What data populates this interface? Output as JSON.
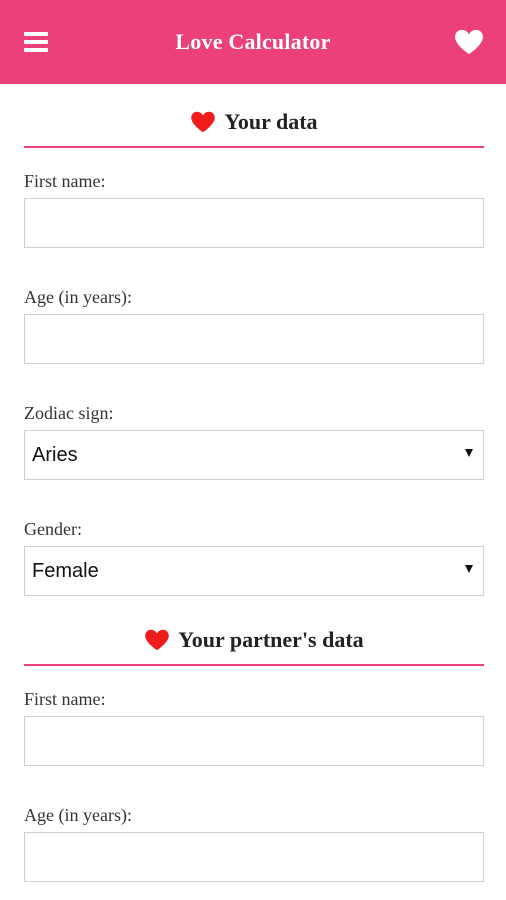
{
  "appbar": {
    "title": "Love Calculator",
    "background": "#ec407a",
    "menu_icon": "hamburger-icon",
    "action_icon": "heart-icon"
  },
  "your_data": {
    "heading": "Your data",
    "heading_icon": "heart-icon",
    "first_name_label": "First name:",
    "first_name_value": "",
    "age_label": "Age (in years):",
    "age_value": "",
    "zodiac_label": "Zodiac sign:",
    "zodiac_value": "Aries",
    "gender_label": "Gender:",
    "gender_value": "Female"
  },
  "partner_data": {
    "heading": "Your partner's data",
    "heading_icon": "heart-icon",
    "first_name_label": "First name:",
    "first_name_value": "",
    "age_label": "Age (in years):",
    "age_value": ""
  },
  "colors": {
    "accent": "#ec407a",
    "heart_red": "#ee1c1c",
    "divider": "#ec407a"
  }
}
